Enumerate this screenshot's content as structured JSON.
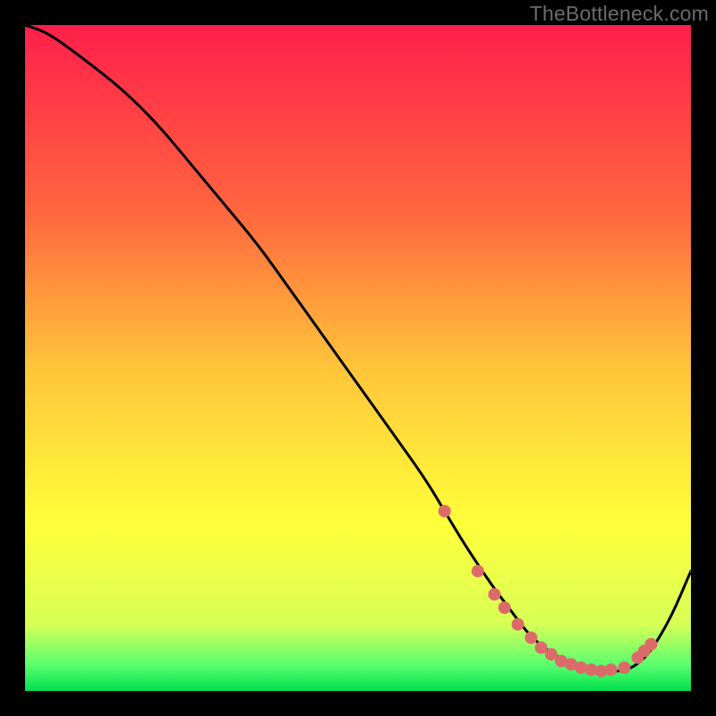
{
  "watermark": "TheBottleneck.com",
  "colors": {
    "grad_top": "#ff1f4b",
    "grad_q1": "#ff663f",
    "grad_mid": "#ffc63a",
    "grad_q3": "#ffff3a",
    "grad_gate1": "#d8ff56",
    "grad_gate2": "#5cff6e",
    "grad_bottom": "#00e050",
    "line": "#000000",
    "dot": "#dd6a6a",
    "frame": "#000000"
  },
  "chart_data": {
    "type": "line",
    "title": "",
    "xlabel": "",
    "ylabel": "",
    "xlim": [
      0,
      100
    ],
    "ylim": [
      0,
      100
    ],
    "series": [
      {
        "name": "bottleneck-curve",
        "x": [
          0,
          3,
          6,
          10,
          15,
          20,
          25,
          30,
          35,
          40,
          45,
          50,
          55,
          60,
          63,
          66,
          70,
          73,
          76,
          80,
          84,
          88,
          90,
          92,
          94,
          97,
          100
        ],
        "y": [
          100,
          99,
          97,
          94,
          90,
          85,
          79,
          73,
          67,
          60,
          53,
          46,
          39,
          32,
          27,
          22,
          16,
          12,
          8,
          5,
          3,
          3,
          3,
          4,
          6,
          11,
          18
        ]
      }
    ],
    "dots": {
      "name": "highlight-points",
      "points": [
        {
          "x": 63,
          "y": 27
        },
        {
          "x": 68,
          "y": 18
        },
        {
          "x": 70.5,
          "y": 14.5
        },
        {
          "x": 72,
          "y": 12.5
        },
        {
          "x": 74,
          "y": 10
        },
        {
          "x": 76,
          "y": 8
        },
        {
          "x": 77.5,
          "y": 6.5
        },
        {
          "x": 79,
          "y": 5.5
        },
        {
          "x": 80.5,
          "y": 4.5
        },
        {
          "x": 82,
          "y": 4
        },
        {
          "x": 83.5,
          "y": 3.5
        },
        {
          "x": 85,
          "y": 3.2
        },
        {
          "x": 86.5,
          "y": 3
        },
        {
          "x": 88,
          "y": 3.2
        },
        {
          "x": 90,
          "y": 3.5
        },
        {
          "x": 92,
          "y": 5
        },
        {
          "x": 93,
          "y": 6
        },
        {
          "x": 94,
          "y": 7
        }
      ]
    }
  }
}
